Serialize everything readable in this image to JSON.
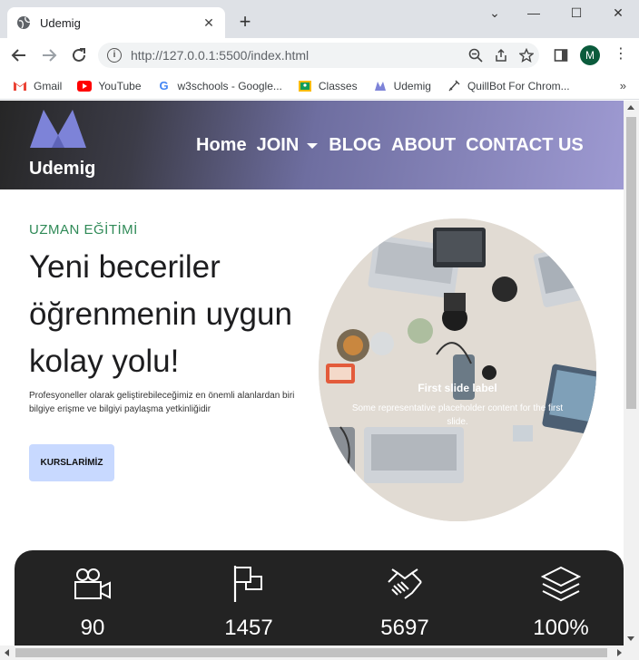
{
  "browser": {
    "tab_title": "Udemig",
    "url": "http://127.0.0.1:5500/index.html",
    "avatar_initial": "M",
    "bookmarks": [
      {
        "label": "Gmail",
        "icon": "gmail-icon"
      },
      {
        "label": "YouTube",
        "icon": "youtube-icon"
      },
      {
        "label": "w3schools - Google...",
        "icon": "google-icon"
      },
      {
        "label": "Classes",
        "icon": "classes-icon"
      },
      {
        "label": "Udemig",
        "icon": "udemig-icon"
      },
      {
        "label": "QuillBot For Chrom...",
        "icon": "quillbot-icon"
      }
    ],
    "bookmarks_more": "»"
  },
  "site": {
    "logo_text": "Udemig",
    "nav": {
      "home": "Home",
      "join": "JOIN",
      "blog": "BLOG",
      "about": "ABOUT",
      "contact": "CONTACT US"
    },
    "hero": {
      "eyebrow": "UZMAN EĞİTİMİ",
      "title": "Yeni beceriler öğrenmenin uygun kolay yolu!",
      "description": "Profesyoneller olarak geliştirebileceğimiz en önemli alanlardan biri bilgiye erişme ve bilgiyi paylaşma yetkinliğidir",
      "button": "KURSLARİMİZ"
    },
    "carousel": {
      "caption_title": "First slide label",
      "caption_text": "Some representative placeholder content for the first slide."
    },
    "stats": [
      {
        "icon": "video-camera-icon",
        "value": "90"
      },
      {
        "icon": "flag-icon",
        "value": "1457"
      },
      {
        "icon": "handshake-icon",
        "value": "5697"
      },
      {
        "icon": "layers-icon",
        "value": "100%"
      }
    ]
  },
  "colors": {
    "eyebrow": "#2f8a57",
    "button_bg": "#c8d9ff",
    "stats_bg": "#232323",
    "logo": "#7d83d8"
  }
}
